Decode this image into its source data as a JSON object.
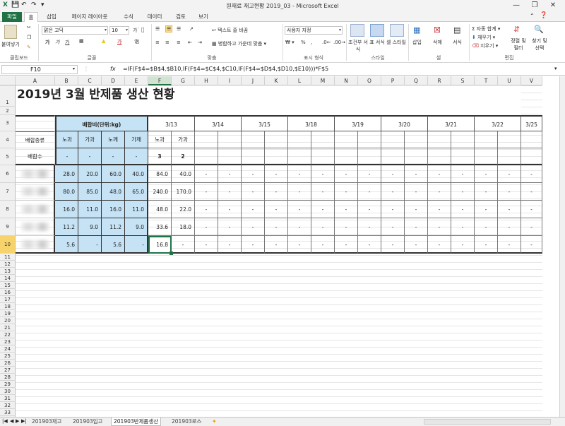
{
  "window": {
    "title": "원재료 재고현황 2019_03 - Microsoft Excel",
    "quick_access": [
      "save-icon",
      "undo-icon",
      "redo-icon"
    ],
    "controls": [
      "minimize-icon",
      "restore-icon",
      "close-icon"
    ]
  },
  "tabs": [
    "파일",
    "홈",
    "삽입",
    "페이지 레이아웃",
    "수식",
    "데이터",
    "검토",
    "보기"
  ],
  "active_tab": "홈",
  "ribbon": {
    "clipboard": {
      "paste": "붙여넣기",
      "label": "클립보드"
    },
    "font": {
      "name": "맑은 고딕",
      "size": "10",
      "label": "글꼴",
      "bold": "가",
      "italic": "가",
      "underline": "가"
    },
    "align": {
      "wrap": "텍스트 줄 바꿈",
      "merge": "병합하고 가운데 맞춤",
      "label": "맞춤"
    },
    "number": {
      "format": "사용자 지정",
      "label": "표시 형식"
    },
    "styles": {
      "cond": "조건부 서식",
      "table": "표 서식",
      "cell": "셀 스타일",
      "label": "스타일"
    },
    "cells": {
      "insert": "삽입",
      "delete": "삭제",
      "format": "서식",
      "label": "셀"
    },
    "edit": {
      "autosum": "자동 합계",
      "fill": "채우기",
      "clear": "지우기",
      "sort": "정렬 및 필터",
      "find": "찾기 및 선택",
      "label": "편집"
    }
  },
  "formula_bar": {
    "name_box": "F10",
    "fx": "fx",
    "formula": "=IF(F$4=$B$4,$B10,IF(F$4=$C$4,$C10,IF(F$4=$D$4,$D10,$E10)))*F$5"
  },
  "columns": [
    "A",
    "B",
    "C",
    "D",
    "E",
    "F",
    "G",
    "H",
    "I",
    "J",
    "K",
    "L",
    "M",
    "N",
    "O",
    "P",
    "Q",
    "R",
    "S",
    "T",
    "U",
    "V"
  ],
  "sheet": {
    "title": "2019년 3월 반제품 생산 현황",
    "ratio_header": "배합비(단위:kg)",
    "dates": [
      "3/13",
      "3/14",
      "3/15",
      "3/18",
      "3/19",
      "3/20",
      "3/21",
      "3/22",
      "3/25"
    ],
    "row4_label": "배합종류",
    "row4_types": [
      "노과",
      "가과",
      "노깨",
      "가깨"
    ],
    "row4_f": "노과",
    "row4_g": "가과",
    "row5_label": "배합수",
    "row5_b_e": [
      "-",
      "-",
      "-",
      "-"
    ],
    "row5_f": "3",
    "row5_g": "2",
    "data_rows": [
      {
        "b": "28.0",
        "c": "20.0",
        "d": "60.0",
        "e": "40.0",
        "f": "84.0",
        "g": "40.0"
      },
      {
        "b": "80.0",
        "c": "85.0",
        "d": "48.0",
        "e": "65.0",
        "f": "240.0",
        "g": "170.0"
      },
      {
        "b": "16.0",
        "c": "11.0",
        "d": "16.0",
        "e": "11.0",
        "f": "48.0",
        "g": "22.0"
      },
      {
        "b": "11.2",
        "c": "9.0",
        "d": "11.2",
        "e": "9.0",
        "f": "33.6",
        "g": "18.0"
      },
      {
        "b": "5.6",
        "c": "-",
        "d": "5.6",
        "e": "-",
        "f": "16.8",
        "g": "-"
      }
    ],
    "dash": "-"
  },
  "sheet_tabs": [
    "201903재고",
    "201903입고",
    "201903반제품생산",
    "201903로스"
  ],
  "active_sheet": "201903반제품생산",
  "colors": {
    "excel_green": "#207245",
    "ratio_fill": "#c6e3f5",
    "selection": "#217346"
  }
}
